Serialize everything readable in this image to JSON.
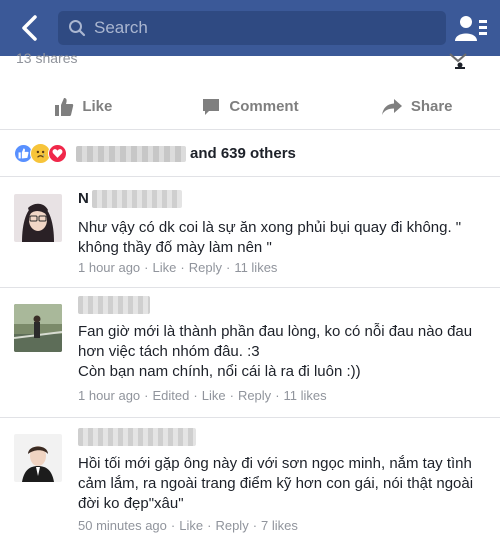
{
  "header": {
    "search_placeholder": "Search"
  },
  "post": {
    "shares_text": "13 shares",
    "actions": {
      "like": "Like",
      "comment": "Comment",
      "share": "Share"
    },
    "reactions": {
      "others_text": "and 639 others"
    }
  },
  "comments": [
    {
      "name_initial": "N",
      "text": "Như vậy có dk coi là sự ăn xong phủi bụi quay đi không. \" không thầy đố mày làm nên \"",
      "time": "1 hour ago",
      "like": "Like",
      "reply": "Reply",
      "likes": "11 likes",
      "edited": ""
    },
    {
      "name_initial": "",
      "text": "Fan giờ mới là thành phần đau lòng, ko có nỗi đau nào đau hơn việc tách nhóm đâu. :3\nCòn bạn nam chính, nổi cái là ra đi luôn :))",
      "time": "1 hour ago",
      "like": "Like",
      "reply": "Reply",
      "likes": "11 likes",
      "edited": "Edited"
    },
    {
      "name_initial": "",
      "text": "Hồi tối mới gặp ông này đi với sơn ngọc minh, nắm tay tình cảm lắm, ra ngoài trang điểm kỹ hơn con gái, nói thật ngoài đời ko đẹp\"xâu\"",
      "time": "50 minutes ago",
      "like": "Like",
      "reply": "Reply",
      "likes": "7 likes",
      "edited": ""
    }
  ],
  "separator": "·",
  "colors": {
    "header_bg": "#3b5998",
    "meta": "#90949c",
    "action": "#7f7f7f",
    "like_blue": "#5890ff",
    "sad_yellow": "#f7c43a",
    "love_red": "#f0284a"
  }
}
